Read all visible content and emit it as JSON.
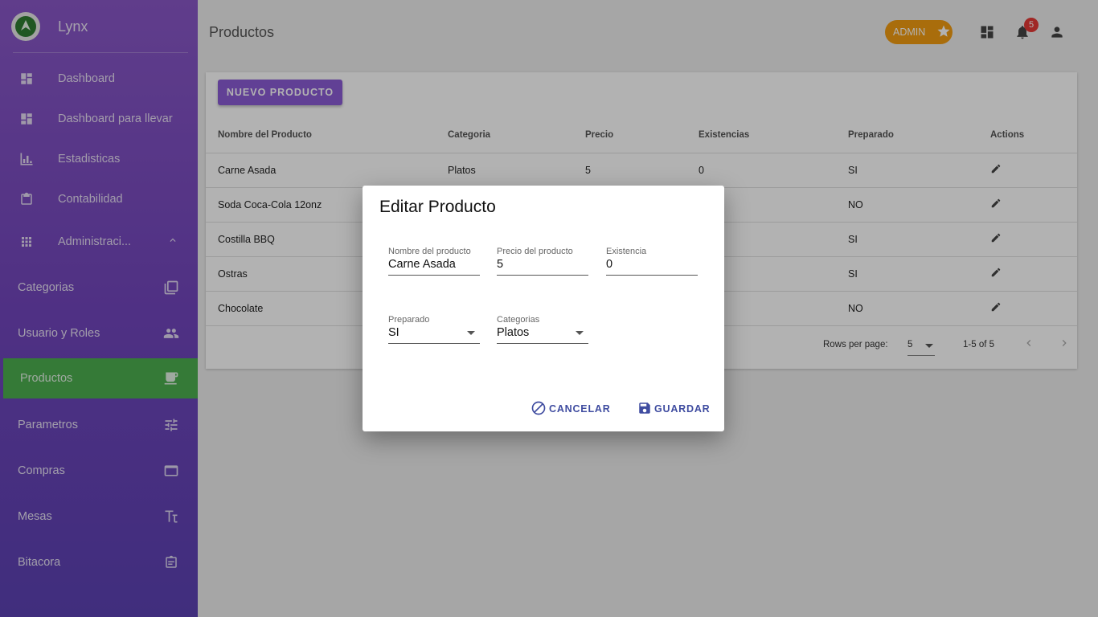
{
  "app": {
    "name": "Lynx"
  },
  "sidebar": {
    "items": [
      {
        "label": "Dashboard",
        "icon": "dashboard-icon"
      },
      {
        "label": "Dashboard para llevar",
        "icon": "dashboard-icon"
      },
      {
        "label": "Estadisticas",
        "icon": "bar-chart-icon"
      },
      {
        "label": "Contabilidad",
        "icon": "clipboard-icon"
      },
      {
        "label": "Administraci...",
        "icon": "apps-grid-icon"
      }
    ],
    "subitems": [
      {
        "label": "Categorias",
        "icon": "library-icon"
      },
      {
        "label": "Usuario y Roles",
        "icon": "people-icon"
      },
      {
        "label": "Productos",
        "icon": "coffee-icon",
        "active": true
      },
      {
        "label": "Parametros",
        "icon": "settings-input-icon"
      },
      {
        "label": "Compras",
        "icon": "window-icon"
      },
      {
        "label": "Mesas",
        "icon": "table-icon"
      },
      {
        "label": "Bitacora",
        "icon": "assignment-icon"
      }
    ]
  },
  "header": {
    "title": "Productos",
    "badge": "ADMIN",
    "notification_count": "5"
  },
  "main": {
    "new_button": "NUEVO PRODUCTO",
    "columns": [
      "Nombre del Producto",
      "Categoria",
      "Precio",
      "Existencias",
      "Preparado",
      "Actions"
    ],
    "rows": [
      {
        "name": "Carne Asada",
        "category": "Platos",
        "price": "5",
        "stock": "0",
        "prepared": "SI"
      },
      {
        "name": "Soda Coca-Cola 12onz",
        "category": "",
        "price": "",
        "stock": "",
        "prepared": "NO"
      },
      {
        "name": "Costilla BBQ",
        "category": "",
        "price": "",
        "stock": "",
        "prepared": "SI"
      },
      {
        "name": "Ostras",
        "category": "",
        "price": "",
        "stock": "",
        "prepared": "SI"
      },
      {
        "name": "Chocolate",
        "category": "",
        "price": "",
        "stock": "",
        "prepared": "NO"
      }
    ],
    "pagination": {
      "rows_per_page_label": "Rows per page:",
      "rows_per_page": "5",
      "range": "1-5 of 5"
    }
  },
  "dialog": {
    "title": "Editar Producto",
    "fields": {
      "name": {
        "label": "Nombre del producto",
        "value": "Carne Asada"
      },
      "price": {
        "label": "Precio del producto",
        "value": "5"
      },
      "stock": {
        "label": "Existencia",
        "value": "0"
      },
      "prepared": {
        "label": "Preparado",
        "value": "SI"
      },
      "category": {
        "label": "Categorias",
        "value": "Platos"
      }
    },
    "cancel_label": "CANCELAR",
    "save_label": "GUARDAR"
  },
  "colors": {
    "sidebar_top": "#8a58c8",
    "sidebar_bottom": "#5c42b4",
    "active_item": "#4caf50",
    "admin_badge": "#f39c12",
    "primary_button": "#8c5cd6",
    "dialog_action": "#3f4ca0",
    "notification": "#e53935"
  }
}
